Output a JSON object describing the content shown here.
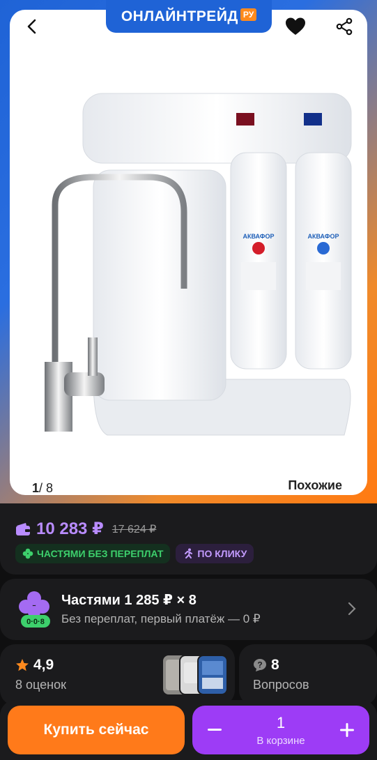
{
  "header": {
    "brand_text": "ОНЛАЙНТРЕЙД",
    "brand_suffix": "РУ",
    "icons": [
      "back-arrow-icon",
      "heart-icon",
      "share-icon"
    ]
  },
  "gallery": {
    "current": "1",
    "total": "/ 8",
    "similar_label": "Похожие",
    "product_labels": [
      "АКВАФОР",
      "АКВАФОР"
    ]
  },
  "price": {
    "current": "10 283 ₽",
    "old": "17 624 ₽",
    "accent_color": "#b98cff",
    "badges": [
      {
        "label": "ЧАСТЯМИ БЕЗ ПЕРЕПЛАТ",
        "icon": "clover-icon",
        "color": "#3dd06c"
      },
      {
        "label": "ПО КЛИКУ",
        "icon": "running-person-icon",
        "color": "#c39bff"
      }
    ]
  },
  "installment": {
    "title": "Частями 1 285 ₽  ×  8",
    "subtitle": "Без переплат, первый платёж — 0 ₽",
    "logo_badge": "0·0·8"
  },
  "rating": {
    "value": "4,9",
    "count_label": "8 оценок"
  },
  "questions": {
    "value": "8",
    "label": "Вопросов"
  },
  "actions": {
    "buy_label": "Купить сейчас",
    "cart_qty": "1",
    "cart_label": "В корзине",
    "buy_color": "#ff7a1a",
    "cart_color": "#9d3cf6"
  }
}
